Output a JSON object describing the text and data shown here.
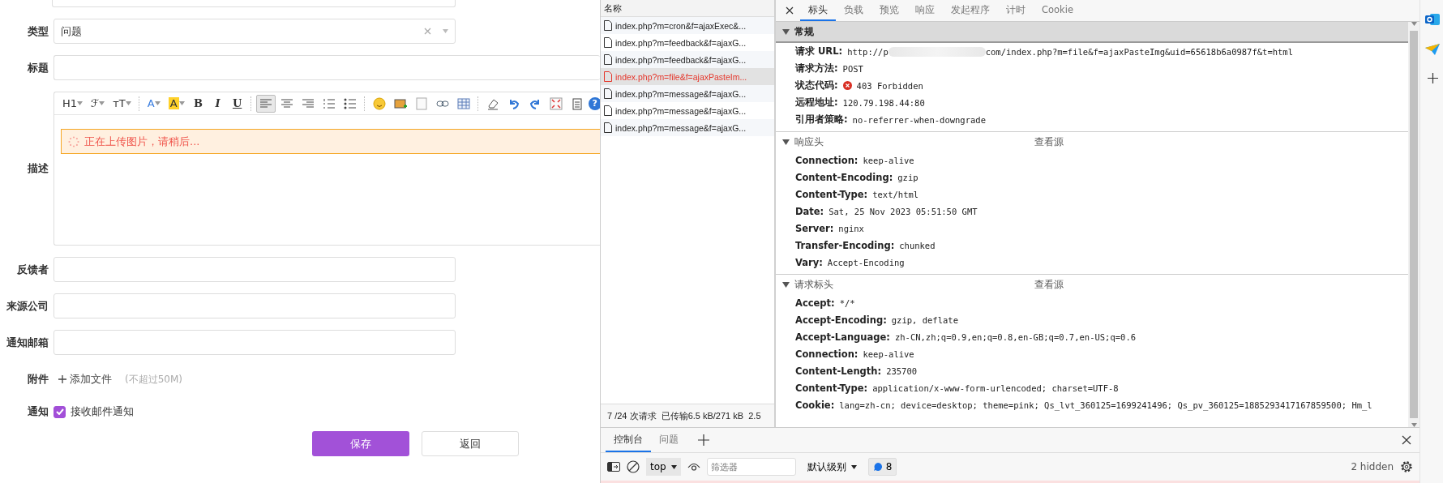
{
  "form": {
    "fields": [
      {
        "kind": "select",
        "label": "类型",
        "value": "问题"
      },
      {
        "kind": "input",
        "label": "标题",
        "wide": true
      },
      {
        "kind": "editor",
        "label": "描述",
        "notice": "正在上传图片，请稍后...",
        "toolbar": [
          {
            "kind": "text",
            "label": "H1",
            "selected": false
          },
          {
            "kind": "text",
            "label": "ℱ",
            "selected": false
          },
          {
            "kind": "text",
            "label": "ᴛT",
            "selected": false
          },
          {
            "kind": "sep"
          },
          {
            "kind": "fontcolor",
            "label": "A",
            "selected": false
          },
          {
            "kind": "highlight",
            "label": "A",
            "selected": false
          },
          {
            "kind": "bold",
            "label": "B",
            "selected": false
          },
          {
            "kind": "italic",
            "label": "I",
            "selected": false
          },
          {
            "kind": "underline",
            "label": "U",
            "selected": false
          },
          {
            "kind": "sep"
          },
          {
            "kind": "align-left",
            "selected": true
          },
          {
            "kind": "align-center",
            "selected": false
          },
          {
            "kind": "align-right",
            "selected": false
          },
          {
            "kind": "ordered-list",
            "selected": false
          },
          {
            "kind": "bullet-list",
            "selected": false
          },
          {
            "kind": "sep"
          },
          {
            "kind": "emoji",
            "selected": false
          },
          {
            "kind": "image",
            "selected": false
          },
          {
            "kind": "code",
            "selected": false
          },
          {
            "kind": "link",
            "selected": false
          },
          {
            "kind": "table",
            "selected": false
          },
          {
            "kind": "sep"
          },
          {
            "kind": "eraser",
            "selected": false
          },
          {
            "kind": "undo",
            "selected": false
          },
          {
            "kind": "redo",
            "selected": false
          },
          {
            "kind": "fullscreen",
            "selected": false
          },
          {
            "kind": "paste",
            "selected": false
          },
          {
            "kind": "help",
            "label": "?",
            "selected": false
          }
        ]
      },
      {
        "kind": "input",
        "label": "反馈者",
        "wide": false
      },
      {
        "kind": "input",
        "label": "来源公司",
        "wide": false
      },
      {
        "kind": "input",
        "label": "通知邮箱",
        "wide": false
      },
      {
        "kind": "file",
        "label": "附件",
        "action": "添加文件",
        "hint": "(不超过50M)"
      },
      {
        "kind": "checkbox",
        "label": "通知",
        "text": "接收邮件通知",
        "checked": true
      }
    ],
    "buttons": [
      {
        "label": "保存",
        "primary": true
      },
      {
        "label": "返回",
        "primary": false
      }
    ]
  },
  "network": {
    "header": "名称",
    "rows": [
      {
        "name": "index.php?m=cron&f=ajaxExec&...",
        "selected": false,
        "error": false
      },
      {
        "name": "index.php?m=feedback&f=ajaxG...",
        "selected": false,
        "error": false
      },
      {
        "name": "index.php?m=feedback&f=ajaxG...",
        "selected": false,
        "error": false
      },
      {
        "name": "index.php?m=file&f=ajaxPasteIm...",
        "selected": true,
        "error": true
      },
      {
        "name": "index.php?m=message&f=ajaxG...",
        "selected": false,
        "error": false
      },
      {
        "name": "index.php?m=message&f=ajaxG...",
        "selected": false,
        "error": false
      },
      {
        "name": "index.php?m=message&f=ajaxG...",
        "selected": false,
        "error": false
      }
    ],
    "status": "7 /24 次请求  已传输6.5 kB/271 kB  2.5"
  },
  "details": {
    "tabs": [
      {
        "label": "标头",
        "selected": true
      },
      {
        "label": "负载",
        "selected": false
      },
      {
        "label": "预览",
        "selected": false
      },
      {
        "label": "响应",
        "selected": false
      },
      {
        "label": "发起程序",
        "selected": false
      },
      {
        "label": "计时",
        "selected": false
      },
      {
        "label": "Cookie",
        "selected": false
      }
    ],
    "sections": [
      {
        "title": "常规",
        "expanded": true,
        "rows": [
          {
            "kind": "redacted",
            "key": "请求 URL:",
            "prefix": "http://p",
            "value": "com/index.php?m=file&f=ajaxPasteImg&uid=65618b6a0987f&t=html"
          },
          {
            "kind": "plain",
            "key": "请求方法:",
            "value": "POST"
          },
          {
            "kind": "status",
            "key": "状态代码:",
            "value": "403 Forbidden"
          },
          {
            "kind": "plain",
            "key": "远程地址:",
            "value": "120.79.198.44:80"
          },
          {
            "kind": "plain",
            "key": "引用者策略:",
            "value": "no-referrer-when-downgrade"
          }
        ]
      },
      {
        "title": "响应头",
        "expanded": true,
        "source": "查看源",
        "rows": [
          {
            "kind": "plain",
            "key": "Connection:",
            "value": "keep-alive"
          },
          {
            "kind": "plain",
            "key": "Content-Encoding:",
            "value": "gzip"
          },
          {
            "kind": "plain",
            "key": "Content-Type:",
            "value": "text/html"
          },
          {
            "kind": "plain",
            "key": "Date:",
            "value": "Sat, 25 Nov 2023 05:51:50 GMT"
          },
          {
            "kind": "plain",
            "key": "Server:",
            "value": "nginx"
          },
          {
            "kind": "plain",
            "key": "Transfer-Encoding:",
            "value": "chunked"
          },
          {
            "kind": "plain",
            "key": "Vary:",
            "value": "Accept-Encoding"
          }
        ]
      },
      {
        "title": "请求标头",
        "expanded": true,
        "source": "查看源",
        "rows": [
          {
            "kind": "plain",
            "key": "Accept:",
            "value": "*/*"
          },
          {
            "kind": "plain",
            "key": "Accept-Encoding:",
            "value": "gzip, deflate"
          },
          {
            "kind": "plain",
            "key": "Accept-Language:",
            "value": "zh-CN,zh;q=0.9,en;q=0.8,en-GB;q=0.7,en-US;q=0.6"
          },
          {
            "kind": "plain",
            "key": "Connection:",
            "value": "keep-alive"
          },
          {
            "kind": "plain",
            "key": "Content-Length:",
            "value": "235700"
          },
          {
            "kind": "plain",
            "key": "Content-Type:",
            "value": "application/x-www-form-urlencoded; charset=UTF-8"
          },
          {
            "kind": "plain",
            "key": "Cookie:",
            "value": "lang=zh-cn; device=desktop; theme=pink; Qs_lvt_360125=1699241496; Qs_pv_360125=1885293417167859500; Hm_l"
          }
        ]
      }
    ]
  },
  "drawer": {
    "tabs": [
      {
        "label": "控制台",
        "selected": true
      },
      {
        "label": "问题",
        "selected": false
      }
    ],
    "context": "top",
    "filter_placeholder": "筛选器",
    "level": "默认级别",
    "messages": "8",
    "hidden": "2 hidden"
  }
}
